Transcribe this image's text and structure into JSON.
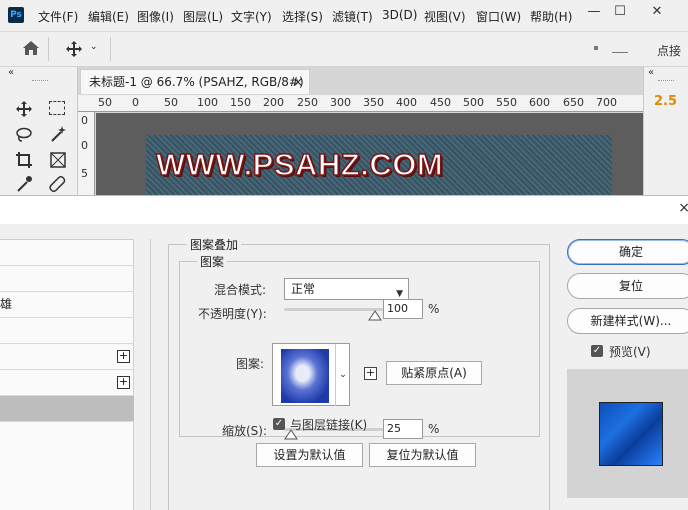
{
  "ps": {
    "logo": "Ps",
    "menu": [
      "文件(F)",
      "编辑(E)",
      "图像(I)",
      "图层(L)",
      "文字(Y)",
      "选择(S)",
      "滤镜(T)",
      "3D(D)",
      "视图(V)",
      "窗口(W)",
      "帮助(H)"
    ],
    "window_controls": [
      "—",
      "☐",
      "✕"
    ],
    "toolbar": {
      "home_icon": "home-icon",
      "move_icon": "move-icon",
      "right_text": "点接"
    },
    "panel_collapse": "«",
    "right_panel_value": "2.5",
    "doc_tab": {
      "title": "未标题-1 @ 66.7% (PSAHZ, RGB/8#) *",
      "close": "×"
    },
    "ruler_h": [
      "50",
      "0",
      "50",
      "100",
      "150",
      "200",
      "250",
      "300",
      "350",
      "400",
      "450",
      "500",
      "550",
      "600",
      "650",
      "700"
    ],
    "ruler_v": [
      "0",
      "0",
      "5"
    ],
    "canvas_text": "WWW.PSAHZ.COM",
    "canvas_color": "#3b5a6b"
  },
  "dialog": {
    "close": "×",
    "style_items": [
      {
        "label": "",
        "plus": ""
      },
      {
        "label": "",
        "plus": ""
      },
      {
        "label": "雄",
        "plus": ""
      },
      {
        "label": "",
        "plus": ""
      },
      {
        "label": "",
        "plus": "+"
      },
      {
        "label": "",
        "plus": "+"
      },
      {
        "label": "",
        "plus": ""
      }
    ],
    "group_title": "图案叠加",
    "subgroup_title": "图案",
    "blend_label": "混合模式:",
    "blend_value": "正常",
    "opacity_label": "不透明度(Y):",
    "opacity_value": "100",
    "opacity_unit": "%",
    "opacity_level": 1.0,
    "pattern_label": "图案:",
    "new_preset": "+",
    "snap_origin_button": "贴紧原点(A)",
    "scale_label": "缩放(S):",
    "scale_value": "25",
    "scale_unit": "%",
    "scale_level": 0.0,
    "link_checkbox": "与图层链接(K)",
    "set_default_button": "设置为默认值",
    "reset_default_button": "复位为默认值",
    "ok_button": "确定",
    "reset_button": "复位",
    "new_style_button": "新建样式(W)...",
    "preview_label": "预览(V)",
    "accent_color": "#3a6fc4"
  }
}
